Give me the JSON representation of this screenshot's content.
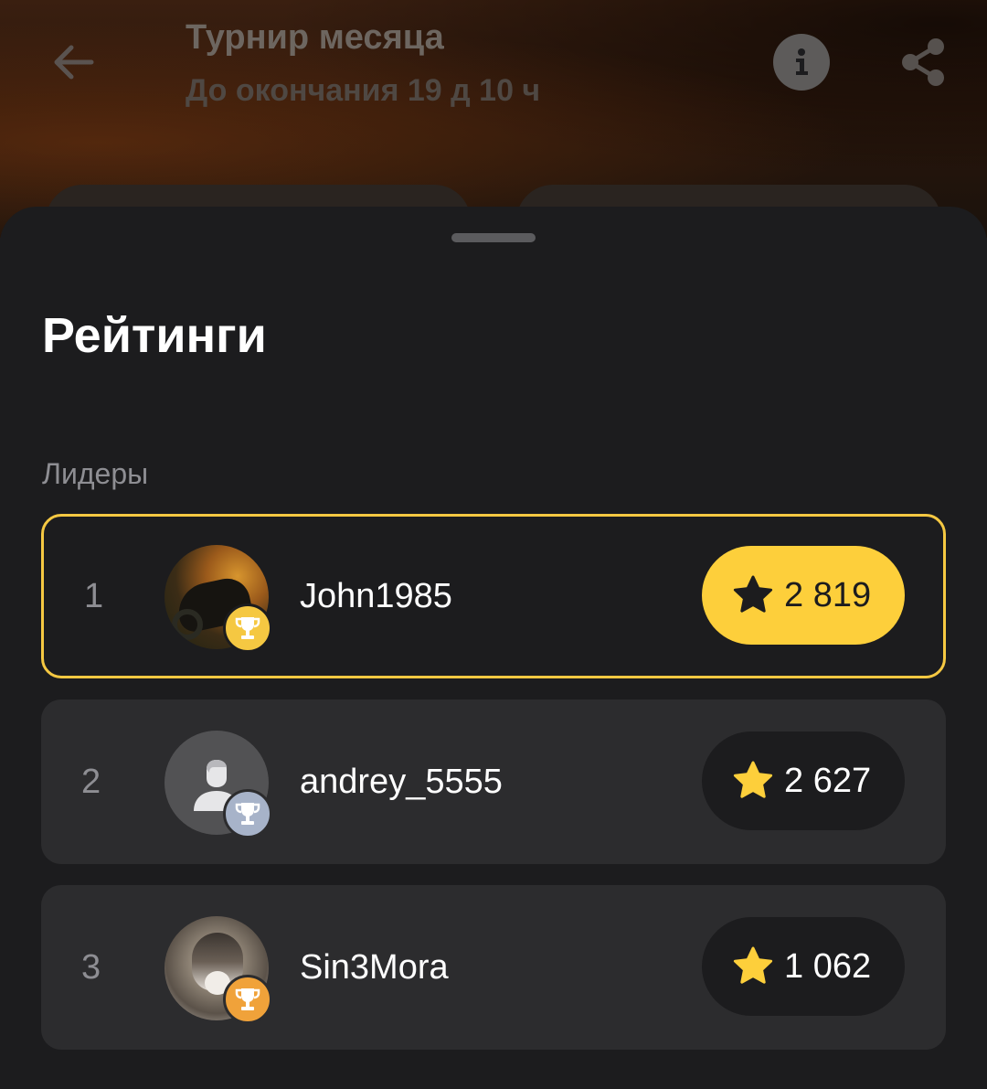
{
  "header": {
    "title": "Турнир месяца",
    "subtitle": "До окончания 19 д 10 ч",
    "back_icon": "arrow-left-icon",
    "info_icon": "info-icon",
    "share_icon": "share-icon"
  },
  "sheet": {
    "title": "Рейтинги",
    "section_label": "Лидеры"
  },
  "leaders": [
    {
      "rank": "1",
      "username": "John1985",
      "score": "2 819",
      "badge": "gold-trophy",
      "highlighted": true
    },
    {
      "rank": "2",
      "username": "andrey_5555",
      "score": "2 627",
      "badge": "silver-trophy",
      "highlighted": false
    },
    {
      "rank": "3",
      "username": "Sin3Mora",
      "score": "1 062",
      "badge": "bronze-trophy",
      "highlighted": false
    }
  ],
  "colors": {
    "accent": "#fdcf3b",
    "highlight_border": "#f5c842",
    "silver": "#a7b3c9",
    "bronze": "#f0a23a",
    "background": "#1c1c1e",
    "row": "#2c2c2e"
  }
}
